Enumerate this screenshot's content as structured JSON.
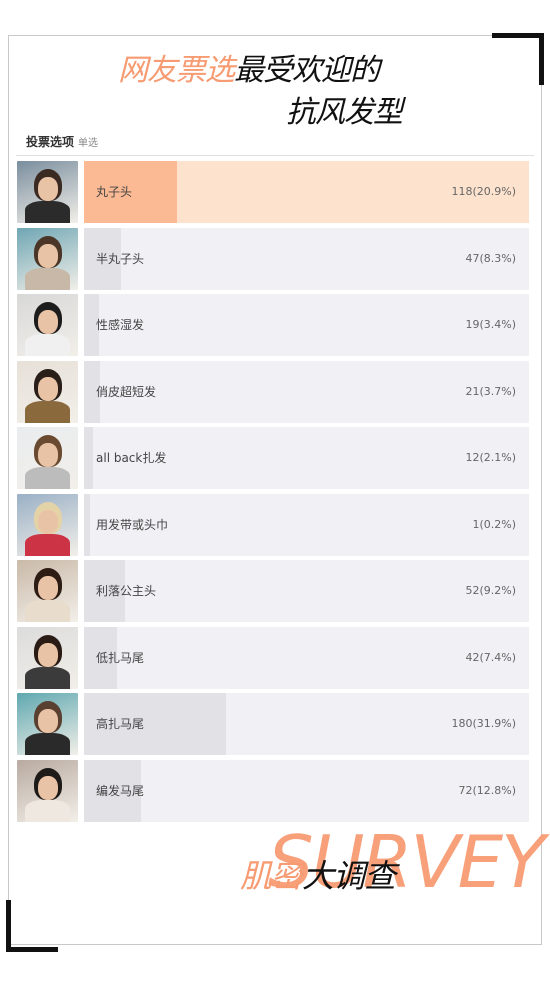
{
  "header": {
    "title_accent": "网友票选",
    "title_rest": "最受欢迎的",
    "title_line2": "抗风发型"
  },
  "poll": {
    "vote_label": "投票选项",
    "mode_label": "单选",
    "options": [
      {
        "label": "丸子头",
        "count": "118(20.9%)",
        "fraction": 0.209,
        "selected": true
      },
      {
        "label": "半丸子头",
        "count": "47(8.3%)",
        "fraction": 0.083,
        "selected": false
      },
      {
        "label": "性感湿发",
        "count": "19(3.4%)",
        "fraction": 0.034,
        "selected": false
      },
      {
        "label": "俏皮超短发",
        "count": "21(3.7%)",
        "fraction": 0.037,
        "selected": false
      },
      {
        "label": "all back扎发",
        "count": "12(2.1%)",
        "fraction": 0.021,
        "selected": false
      },
      {
        "label": "用发带或头巾",
        "count": "1(0.2%)",
        "fraction": 0.002,
        "selected": false
      },
      {
        "label": "利落公主头",
        "count": "52(9.2%)",
        "fraction": 0.092,
        "selected": false
      },
      {
        "label": "低扎马尾",
        "count": "42(7.4%)",
        "fraction": 0.074,
        "selected": false
      },
      {
        "label": "高扎马尾",
        "count": "180(31.9%)",
        "fraction": 0.319,
        "selected": false
      },
      {
        "label": "编发马尾",
        "count": "72(12.8%)",
        "fraction": 0.128,
        "selected": false
      }
    ]
  },
  "footer": {
    "survey_word": "SURVEY",
    "brand_accent": "肌密",
    "brand_rest": "大调查"
  },
  "colors": {
    "accent": "#f79b72",
    "selected_track": "#fde3cd",
    "selected_fill": "#fbb994",
    "track": "#f1f0f4",
    "fill": "#e2e1e6"
  },
  "thumbnails": [
    {
      "icon": "photo-woman-sunglasses-bun",
      "bg": "#7a8e9e",
      "hair": "#3a2a22",
      "body": "#2b2b2b"
    },
    {
      "icon": "photo-woman-half-bun",
      "bg": "#6fa6b4",
      "hair": "#4a3526",
      "body": "#c8b8a8"
    },
    {
      "icon": "photo-woman-wet-hair",
      "bg": "#d8d8d8",
      "hair": "#1c1c1c",
      "body": "#f0f0f0"
    },
    {
      "icon": "photo-woman-short-hair",
      "bg": "#e6e0d8",
      "hair": "#2a1f18",
      "body": "#8a6a3c"
    },
    {
      "icon": "photo-woman-all-back",
      "bg": "#e9ecef",
      "hair": "#6a4a30",
      "body": "#bcbcbc"
    },
    {
      "icon": "photo-woman-headband",
      "bg": "#9ab0c6",
      "hair": "#e5d3a8",
      "body": "#cc3344"
    },
    {
      "icon": "photo-woman-half-up",
      "bg": "#c9b9a8",
      "hair": "#2c1c14",
      "body": "#e8dccc"
    },
    {
      "icon": "photo-woman-low-ponytail",
      "bg": "#dcdcdc",
      "hair": "#2a1c14",
      "body": "#3b3b3b"
    },
    {
      "icon": "photo-woman-high-ponytail",
      "bg": "#5fa8b0",
      "hair": "#5a4030",
      "body": "#2a2a2a"
    },
    {
      "icon": "photo-woman-braid-ponytail",
      "bg": "#b8aaa0",
      "hair": "#1e1a18",
      "body": "#efe8e0"
    }
  ]
}
